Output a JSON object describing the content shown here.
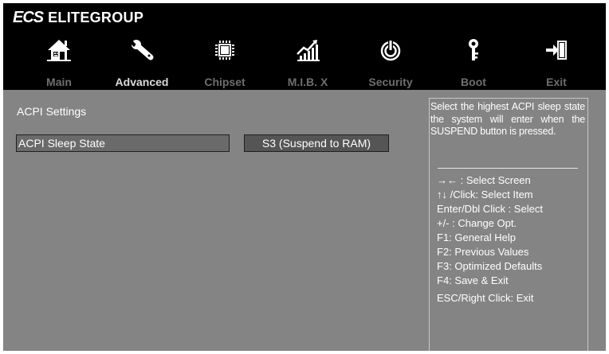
{
  "brand": {
    "logo": "ECS",
    "name": "ELITEGROUP"
  },
  "nav": {
    "tabs": [
      {
        "label": "Main",
        "icon": "home-icon"
      },
      {
        "label": "Advanced",
        "icon": "wrench-icon"
      },
      {
        "label": "Chipset",
        "icon": "chip-icon"
      },
      {
        "label": "M.I.B. X",
        "icon": "chart-icon"
      },
      {
        "label": "Security",
        "icon": "power-icon"
      },
      {
        "label": "Boot",
        "icon": "key-icon"
      },
      {
        "label": "Exit",
        "icon": "exit-icon"
      }
    ],
    "active": "Advanced"
  },
  "main": {
    "section_title": "ACPI Settings",
    "setting": {
      "label": "ACPI Sleep State",
      "value": "S3 (Suspend to RAM)"
    }
  },
  "help": {
    "description": "Select the highest ACPI sleep state the system will enter when the SUSPEND button is pressed.",
    "keys": [
      "→← :  Select Screen",
      "↑↓ /Click: Select Item",
      "Enter/Dbl Click : Select",
      "+/- : Change Opt.",
      "F1: General Help",
      "F2: Previous Values",
      "F3: Optimized Defaults",
      "F4: Save & Exit",
      "ESC/Right Click: Exit"
    ]
  },
  "colors": {
    "background": "#848484",
    "header": "#000000",
    "text": "#ffffff",
    "inactive_tab": "#6e6e6e",
    "active_tab": "#dcdcdc"
  }
}
